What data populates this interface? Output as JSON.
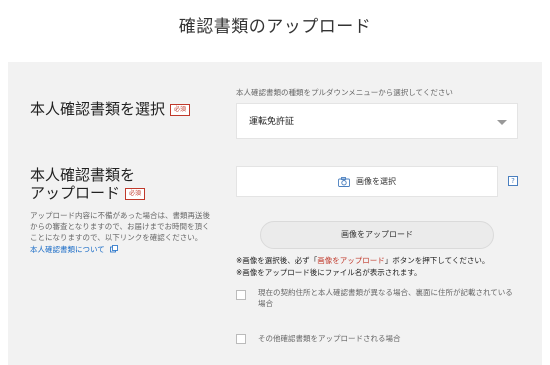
{
  "page": {
    "title": "確認書類のアップロード"
  },
  "section_select": {
    "heading": "本人確認書類を選択",
    "required_badge": "必須",
    "hint": "本人確認書類の種類をプルダウンメニューから選択してください",
    "selected_value": "運転免許証"
  },
  "section_upload": {
    "heading_line1": "本人確認書類を",
    "heading_line2": "アップロード",
    "required_badge": "必須",
    "description_lines": [
      "アップロード内容に不備があった場合は、書類再送後",
      "からの審査となりますので、お届けまでお時間を頂く",
      "ことになりますので、以下リンクを確認ください。"
    ],
    "link_label": "本人確認書類について",
    "file_button_label": "画像を選択",
    "help_label": "?",
    "upload_button_label": "画像をアップロード",
    "note1_before": "※画像を選択後、必ず「",
    "note1_emphasis": "画像をアップロード",
    "note1_after": "」ボタンを押下してください。",
    "note2": "※画像をアップロード後にファイル名が表示されます。"
  },
  "checkboxes": [
    {
      "label_lines": [
        "現在の契約住所と本人確認書類が異なる場合、裏面に住所が記載されている",
        "場合"
      ],
      "checked": false
    },
    {
      "label_lines": [
        "その他確認書類をアップロードされる場合"
      ],
      "checked": false
    }
  ],
  "colors": {
    "accent_red": "#c0392b",
    "link_blue": "#1a6cc7",
    "panel_bg": "#f2f2f2"
  }
}
